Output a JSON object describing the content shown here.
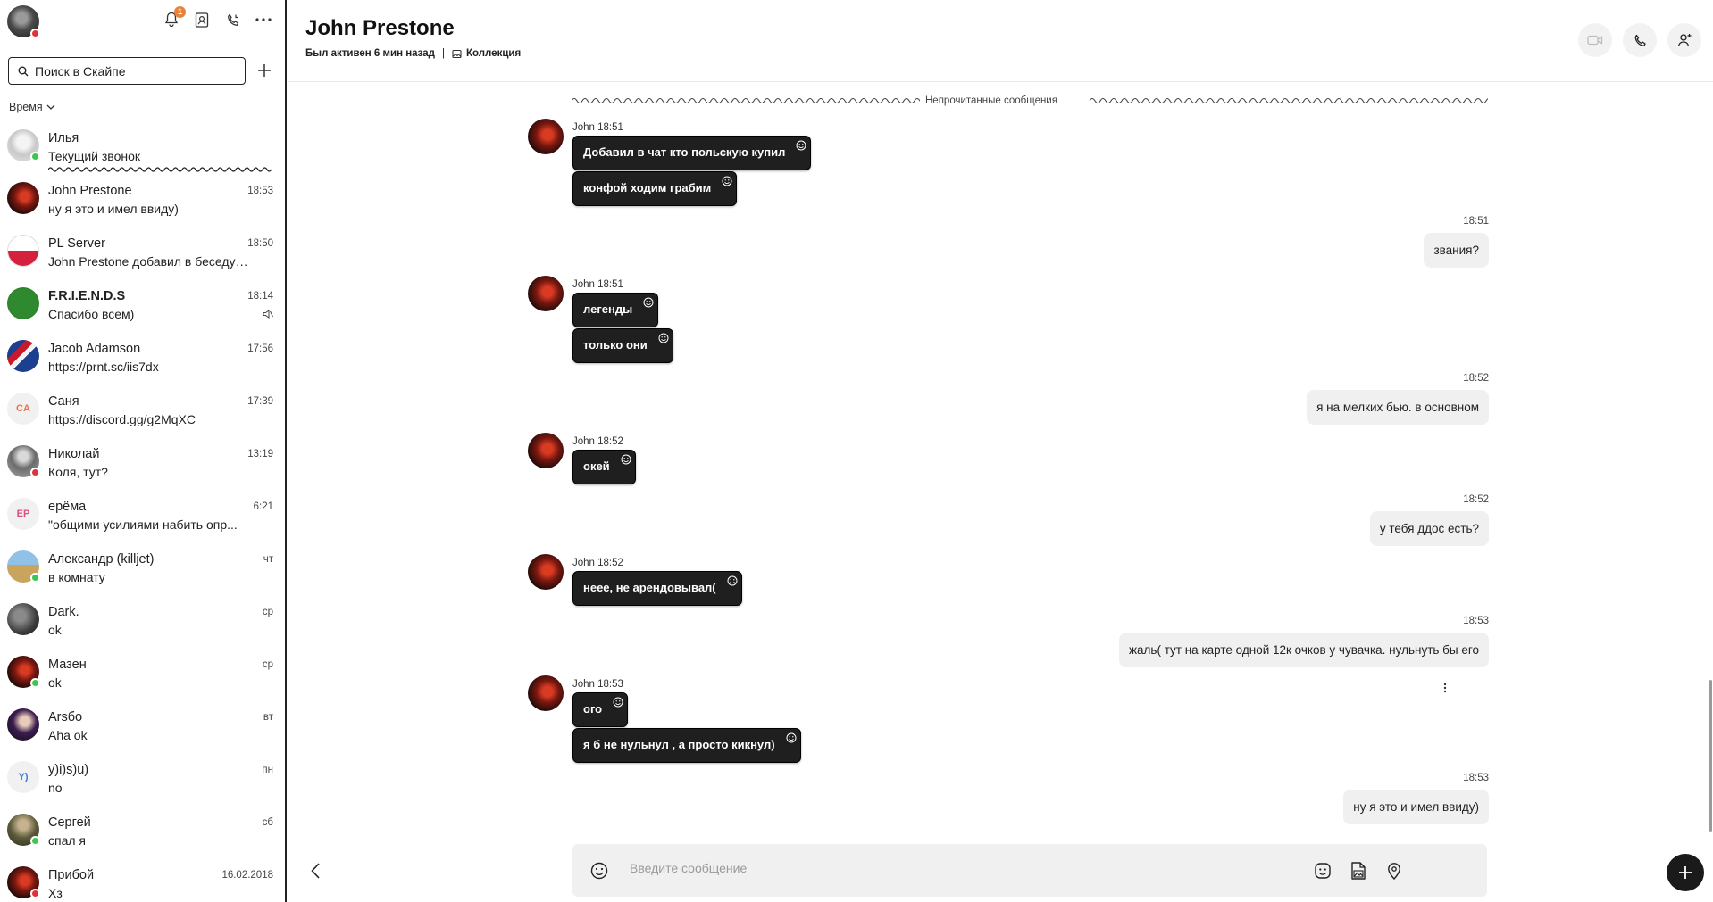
{
  "sidebar": {
    "notification_count": "1",
    "search": {
      "placeholder": "Поиск в Скайпе"
    },
    "sort_label": "Время",
    "chats": [
      {
        "name": "Илья",
        "preview": "Текущий звонок",
        "time": "",
        "avatar": "gray-face",
        "status": "online"
      },
      {
        "name": "John Prestone",
        "preview": "ну я это и имел ввиду)",
        "time": "18:53",
        "avatar": "red-dark",
        "status": ""
      },
      {
        "name": "PL Server",
        "preview": "John Prestone добавил в беседу Богдан...",
        "time": "18:50",
        "avatar": "poland-flag",
        "status": ""
      },
      {
        "name": "F.R.I.E.N.D.S",
        "preview": "Спасибо всем)",
        "time": "18:14",
        "avatar": "friends-green",
        "status": "",
        "muted": true
      },
      {
        "name": "Jacob Adamson",
        "preview": "https://prnt.sc/iis7dx",
        "time": "17:56",
        "avatar": "uk-flag",
        "status": ""
      },
      {
        "name": "Саня",
        "preview": "https://discord.gg/g2MqXC",
        "time": "17:39",
        "avatar": "initials",
        "initials": "CA",
        "initials_color": "#e8734a",
        "status": ""
      },
      {
        "name": "Николай",
        "preview": "Коля, тут?",
        "time": "13:19",
        "avatar": "gray-person",
        "status": "dnd"
      },
      {
        "name": "ерёма",
        "preview": "\"общими усилиями набить опр...",
        "time": "6:21",
        "avatar": "initials",
        "initials": "EP",
        "initials_color": "#d9527e",
        "status": ""
      },
      {
        "name": "Александр  (killjet)",
        "preview": "в комнату",
        "time": "чт",
        "avatar": "sand-person",
        "status": "online"
      },
      {
        "name": "Dark.",
        "preview": "ok",
        "time": "ср",
        "avatar": "dark-gray",
        "status": ""
      },
      {
        "name": "Мазен",
        "preview": "ok",
        "time": "ср",
        "avatar": "red-dark",
        "status": "online"
      },
      {
        "name": "Arsбo",
        "preview": "Aha ok",
        "time": "вт",
        "avatar": "purple-face",
        "status": ""
      },
      {
        "name": "y)i)s)u)",
        "preview": "no",
        "time": "пн",
        "avatar": "initials",
        "initials": "Y)",
        "initials_color": "#3a7bd5",
        "status": ""
      },
      {
        "name": "Сергей",
        "preview": "спал я",
        "time": "сб",
        "avatar": "olive-person",
        "status": "online"
      },
      {
        "name": "Прибой",
        "preview": "Хз",
        "time": "16.02.2018",
        "avatar": "red-dark",
        "status": "dnd"
      }
    ]
  },
  "header": {
    "title": "John Prestone",
    "last_seen": "Был активен 6 мин назад",
    "separator": "|",
    "collection": "Коллекция"
  },
  "conversation": {
    "unread_label": "Непрочитанные сообщения",
    "groups": [
      {
        "from": "John 18:51",
        "messages": [
          "Добавил в чат кто польскую купил",
          "конфой ходим грабим"
        ]
      },
      {
        "own_time": "18:51",
        "message": "звания?"
      },
      {
        "from": "John 18:51",
        "messages": [
          "легенды",
          "только они"
        ]
      },
      {
        "own_time": "18:52",
        "message": "я на мелких бью. в основном"
      },
      {
        "from": "John 18:52",
        "messages": [
          "окей"
        ]
      },
      {
        "own_time": "18:52",
        "message": "у тебя ддос есть?"
      },
      {
        "from": "John 18:52",
        "messages": [
          "неее, не арендовывал("
        ]
      },
      {
        "own_time": "18:53",
        "message": "жаль( тут на карте одной 12к очков у чувачка. нульнуть бы его"
      },
      {
        "from": "John 18:53",
        "messages": [
          "ого",
          "я б не нульнул , а просто кикнул)"
        ]
      },
      {
        "own_time": "18:53",
        "message": "ну я это и имел ввиду)"
      }
    ]
  },
  "composer": {
    "placeholder": "Введите сообщение"
  }
}
